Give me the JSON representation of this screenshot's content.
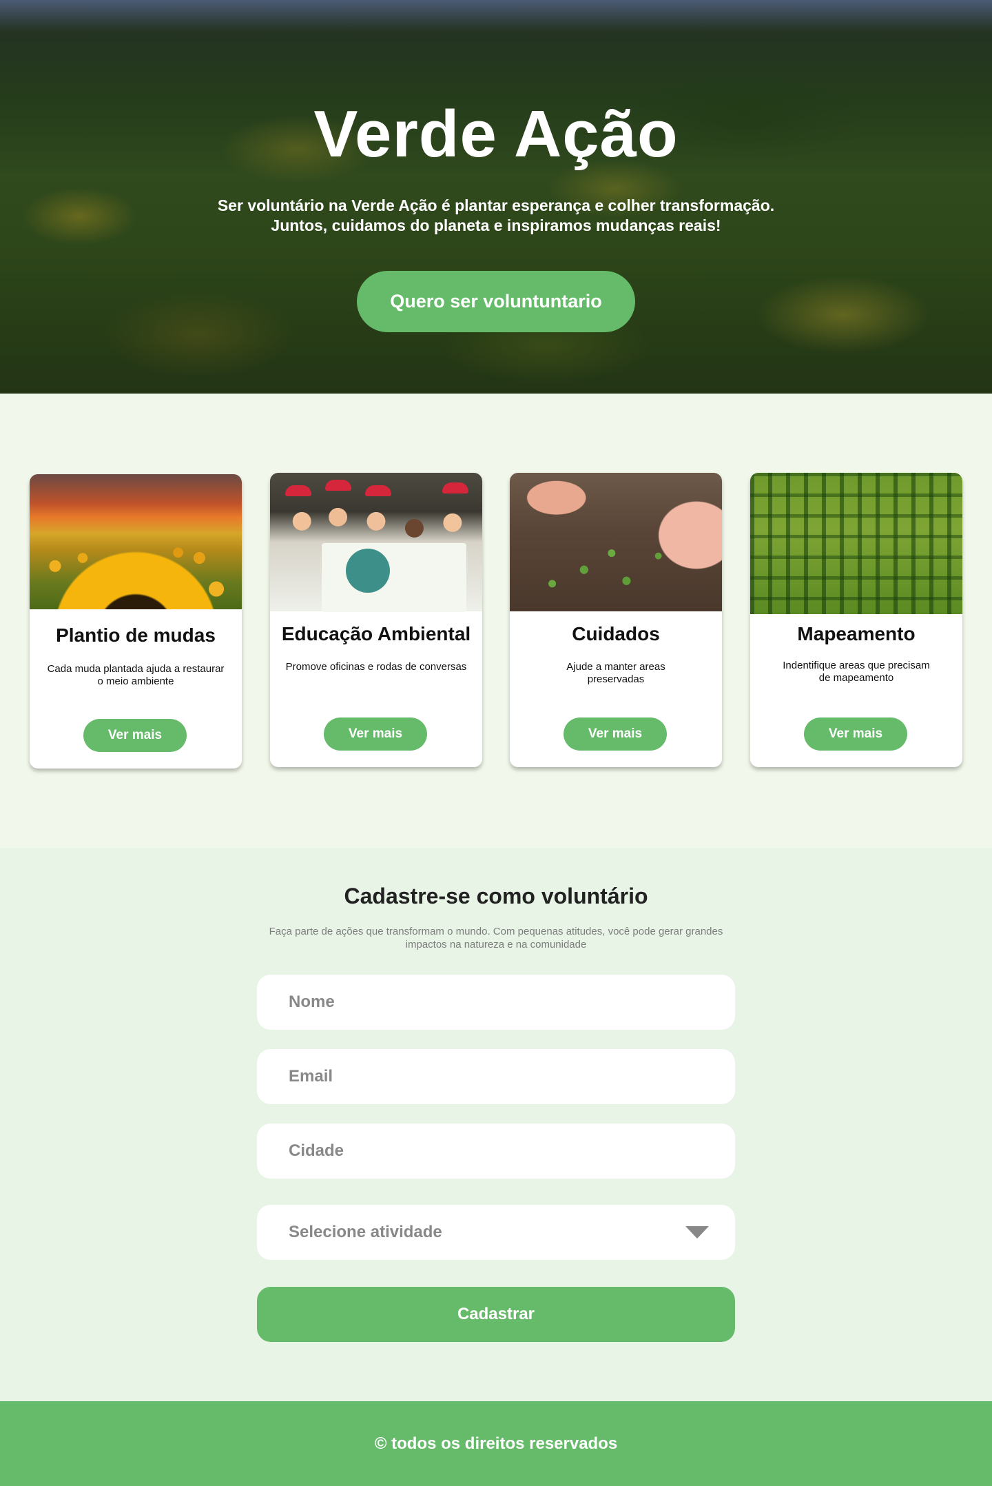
{
  "hero": {
    "title": "Verde Ação",
    "subtitle_line1": "Ser voluntário na Verde Ação é plantar esperança e colher transformação.",
    "subtitle_line2": "Juntos, cuidamos do planeta e inspiramos mudanças reais!",
    "cta_label": "Quero ser voluntuntario"
  },
  "cards": [
    {
      "title": "Plantio de mudas",
      "description": "Cada muda plantada ajuda a restaurar o meio ambiente",
      "button_label": "Ver mais",
      "image": "sunflower-field"
    },
    {
      "title": "Educação Ambiental",
      "description": "Promove oficinas e rodas de conversas",
      "button_label": "Ver mais",
      "image": "children-with-recycling-banner"
    },
    {
      "title": "Cuidados",
      "description": "Ajude a manter areas preservadas",
      "button_label": "Ver mais",
      "image": "hands-gardening-seedlings"
    },
    {
      "title": "Mapeamento",
      "description": "Indentifique areas que precisam de mapeamento",
      "button_label": "Ver mais",
      "image": "pine-forest-aerial"
    }
  ],
  "form": {
    "title": "Cadastre-se como voluntário",
    "description": "Faça parte de ações que transformam o mundo. Com pequenas atitudes, você pode gerar grandes impactos na natureza e na comunidade",
    "name_placeholder": "Nome",
    "email_placeholder": "Email",
    "city_placeholder": "Cidade",
    "activity_placeholder": "Selecione atividade",
    "submit_label": "Cadastrar"
  },
  "footer": {
    "text": "© todos os direitos reservados"
  },
  "colors": {
    "accent_green": "#66bb6a",
    "cards_bg": "#f1f7ea",
    "form_bg": "#e7f4e6"
  }
}
